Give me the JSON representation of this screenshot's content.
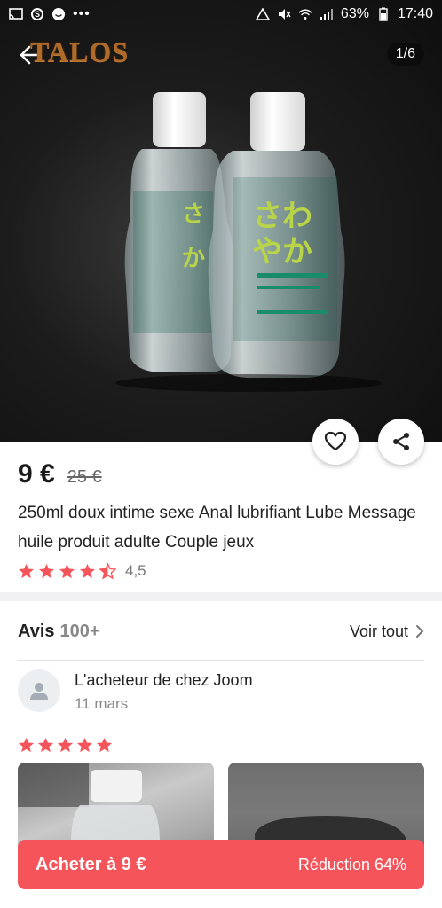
{
  "status_bar": {
    "battery": "63%",
    "time": "17:40"
  },
  "header": {
    "brand": "TALOS",
    "image_counter": "1/6"
  },
  "product": {
    "price": "9 €",
    "old_price": "25 €",
    "title": "250ml doux intime sexe Anal lubrifiant Lube Message huile produit adulte Couple jeux",
    "rating": 4.5,
    "rating_text": "4,5"
  },
  "reviews": {
    "title": "Avis",
    "count": "100+",
    "see_all": "Voir tout",
    "items": [
      {
        "author": "L'acheteur de chez Joom",
        "date": "11 mars",
        "stars": 5
      }
    ]
  },
  "buy_bar": {
    "label": "Acheter à 9 €",
    "discount": "Réduction 64%"
  },
  "colors": {
    "accent": "#f4545a",
    "star": "#f4545a"
  }
}
